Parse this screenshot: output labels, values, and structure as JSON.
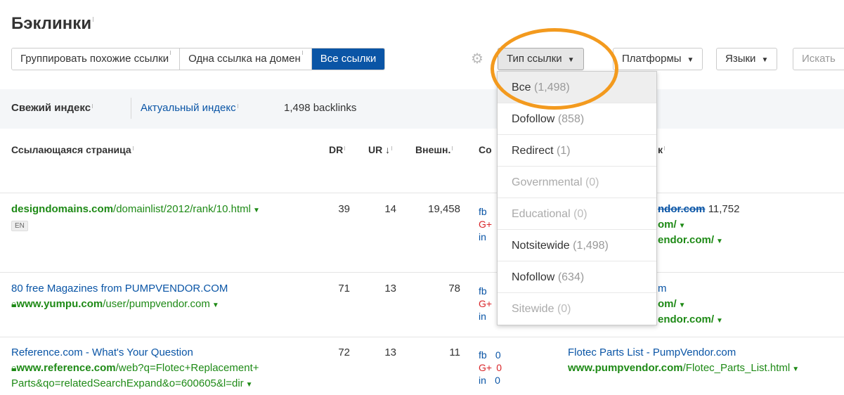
{
  "page": {
    "title": "Бэклинки"
  },
  "toolbar": {
    "group_options": [
      "Группировать похожие ссылки",
      "Одна ссылка на домен",
      "Все ссылки"
    ],
    "link_type": "Тип ссылки",
    "platforms": "Платформы",
    "languages": "Языки",
    "search": "Искать"
  },
  "index_bar": {
    "fresh": "Свежий индекс",
    "actual": "Актуальный индекс",
    "count": "1,498 backlinks"
  },
  "table": {
    "headers": {
      "referring_page": "Ссылающаяся страница",
      "dr": "DR",
      "ur": "UR",
      "external": "Внешн.",
      "social": "Со",
      "anchor": "к"
    },
    "rows": [
      {
        "title": "",
        "domain": "designdomains.com",
        "path": "/domainlist/2012/rank/10.html",
        "lang": "EN",
        "dr": "39",
        "ur": "14",
        "ext": "19,458",
        "social": {
          "fb": "fb",
          "gp": "G+",
          "in": "in"
        },
        "anchor": {
          "line1_strike": "ndor.com",
          "line1_num": "11,752",
          "line2": "om/",
          "line3": "endor.com/"
        }
      },
      {
        "title": "80 free Magazines from PUMPVENDOR.COM",
        "domain": "www.yumpu.com",
        "path": "/user/pumpvendor.com",
        "dr": "71",
        "ur": "13",
        "ext": "78",
        "social": {
          "fb": "fb",
          "gp": "G+",
          "in": "in"
        },
        "anchor": {
          "line1": "m",
          "line2": "om/",
          "line3": "endor.com/"
        }
      },
      {
        "title": "Reference.com - What's Your Question",
        "domain": "www.reference.com",
        "path_line1": "/web?q=Flotec+Replacement+",
        "path_line2": "Parts&qo=relatedSearchExpand&o=600605&l=dir",
        "dr": "72",
        "ur": "13",
        "ext": "11",
        "social": {
          "fb": "fb",
          "gp": "G+",
          "in": "in",
          "fb_v": "0",
          "gp_v": "0",
          "in_v": "0"
        },
        "anchor": {
          "title": "Flotec Parts List - PumpVendor.com",
          "domain": "www.pumpvendor.com",
          "path": "/Flotec_Parts_List.html"
        }
      }
    ]
  },
  "dropdown": {
    "items": [
      {
        "label": "Все",
        "count": "(1,498)"
      },
      {
        "label": "Dofollow",
        "count": "(858)"
      },
      {
        "label": "Redirect",
        "count": "(1)"
      },
      {
        "label": "Governmental",
        "count": "(0)"
      },
      {
        "label": "Educational",
        "count": "(0)"
      },
      {
        "label": "Notsitewide",
        "count": "(1,498)"
      },
      {
        "label": "Nofollow",
        "count": "(634)"
      },
      {
        "label": "Sitewide",
        "count": "(0)"
      }
    ]
  },
  "colors": {
    "accent": "#0a55a6",
    "link_green": "#1e8a16",
    "highlight_circle": "#f39a1e",
    "gplus_red": "#d9262a"
  }
}
